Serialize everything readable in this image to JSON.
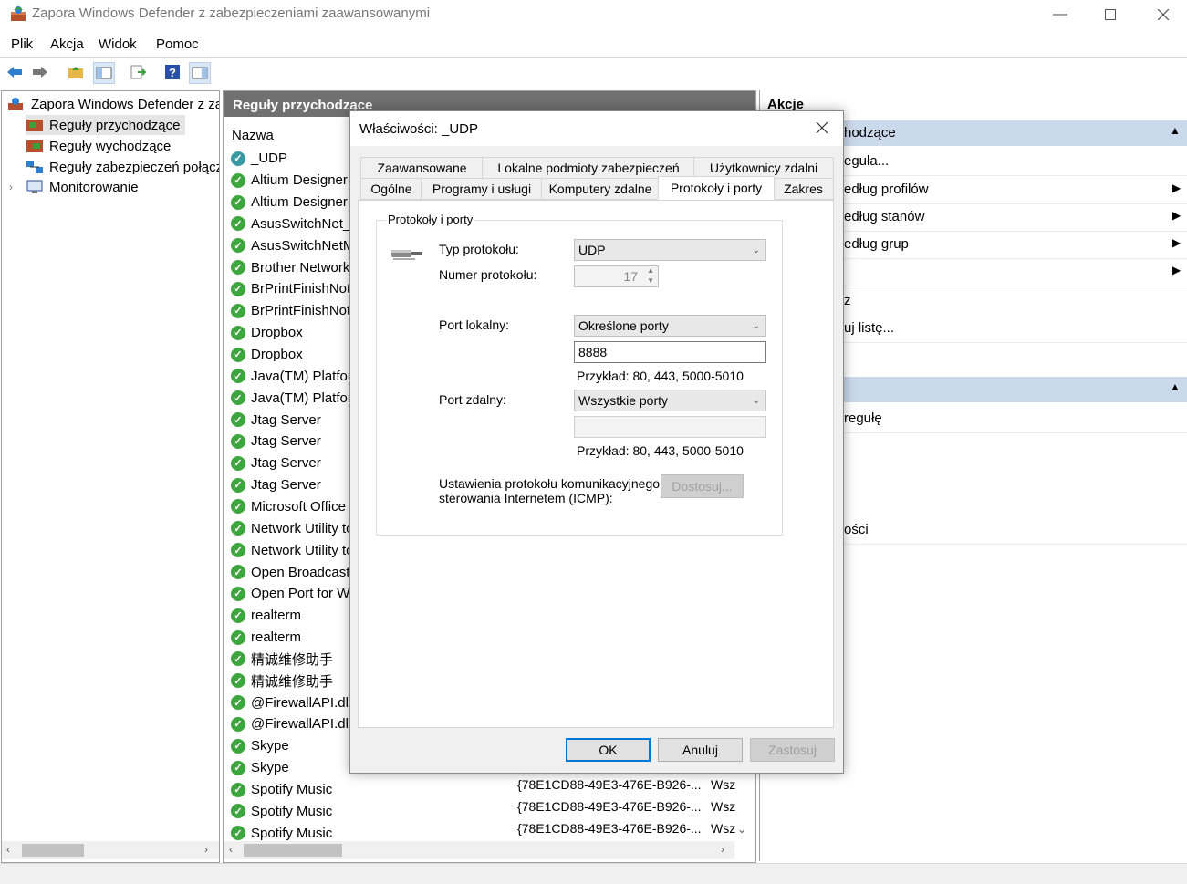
{
  "window": {
    "title": "Zapora Windows Defender z zabezpieczeniami zaawansowanymi"
  },
  "menu": [
    "Plik",
    "Akcja",
    "Widok",
    "Pomoc"
  ],
  "tree": {
    "root": "Zapora Windows Defender z zab",
    "items": [
      "Reguły przychodzące",
      "Reguły wychodzące",
      "Reguły zabezpieczeń połącz",
      "Monitorowanie"
    ]
  },
  "middle": {
    "header": "Reguły przychodzące",
    "column_name": "Nazwa",
    "rules": [
      "_UDP",
      "Altium Designer",
      "Altium Designer",
      "AsusSwitchNet_5",
      "AsusSwitchNetM",
      "Brother Network",
      "BrPrintFinishNoti",
      "BrPrintFinishNoti",
      "Dropbox",
      "Dropbox",
      "Java(TM) Platform",
      "Java(TM) Platform",
      "Jtag Server",
      "Jtag Server",
      "Jtag Server",
      "Jtag Server",
      "Microsoft Office ",
      "Network Utility to",
      "Network Utility to",
      "Open Broadcast ",
      "Open Port for Wo",
      "realterm",
      "realterm",
      "精诚维修助手",
      "精诚维修助手",
      "@FirewallAPI.dll,-",
      "@FirewallAPI.dll,-",
      "Skype",
      "Skype",
      "Spotify Music",
      "Spotify Music",
      "Spotify Music"
    ],
    "spotify_group": "{78E1CD88-49E3-476E-B926-...",
    "spotify_profile": "Wsz"
  },
  "actions": {
    "header": "Akcje",
    "section1": "hodzące",
    "items1": [
      "eguła...",
      "edług profilów",
      "edług stanów",
      "edług grup",
      "",
      "z",
      "uj listę..."
    ],
    "section2": "",
    "items2": [
      "regułę",
      "ości"
    ]
  },
  "dialog": {
    "title": "Właściwości: _UDP",
    "tabs_row1": [
      "Zaawansowane",
      "Lokalne podmioty zabezpieczeń",
      "Użytkownicy zdalni"
    ],
    "tabs_row2": [
      "Ogólne",
      "Programy i usługi",
      "Komputery zdalne",
      "Protokoły i porty",
      "Zakres"
    ],
    "group_title": "Protokoły i porty",
    "protocol_type_label": "Typ protokołu:",
    "protocol_type_value": "UDP",
    "protocol_number_label": "Numer protokołu:",
    "protocol_number_value": "17",
    "local_port_label": "Port lokalny:",
    "local_port_value": "Określone porty",
    "local_port_input": "8888",
    "example1": "Przykład: 80, 443, 5000-5010",
    "remote_port_label": "Port zdalny:",
    "remote_port_value": "Wszystkie porty",
    "remote_port_input": "",
    "example2": "Przykład: 80, 443, 5000-5010",
    "icmp_label_1": "Ustawienia protokołu komunikacyjnego",
    "icmp_label_2": "sterowania Internetem (ICMP):",
    "customize_button": "Dostosuj...",
    "ok_button": "OK",
    "cancel_button": "Anuluj",
    "apply_button": "Zastosuj"
  }
}
